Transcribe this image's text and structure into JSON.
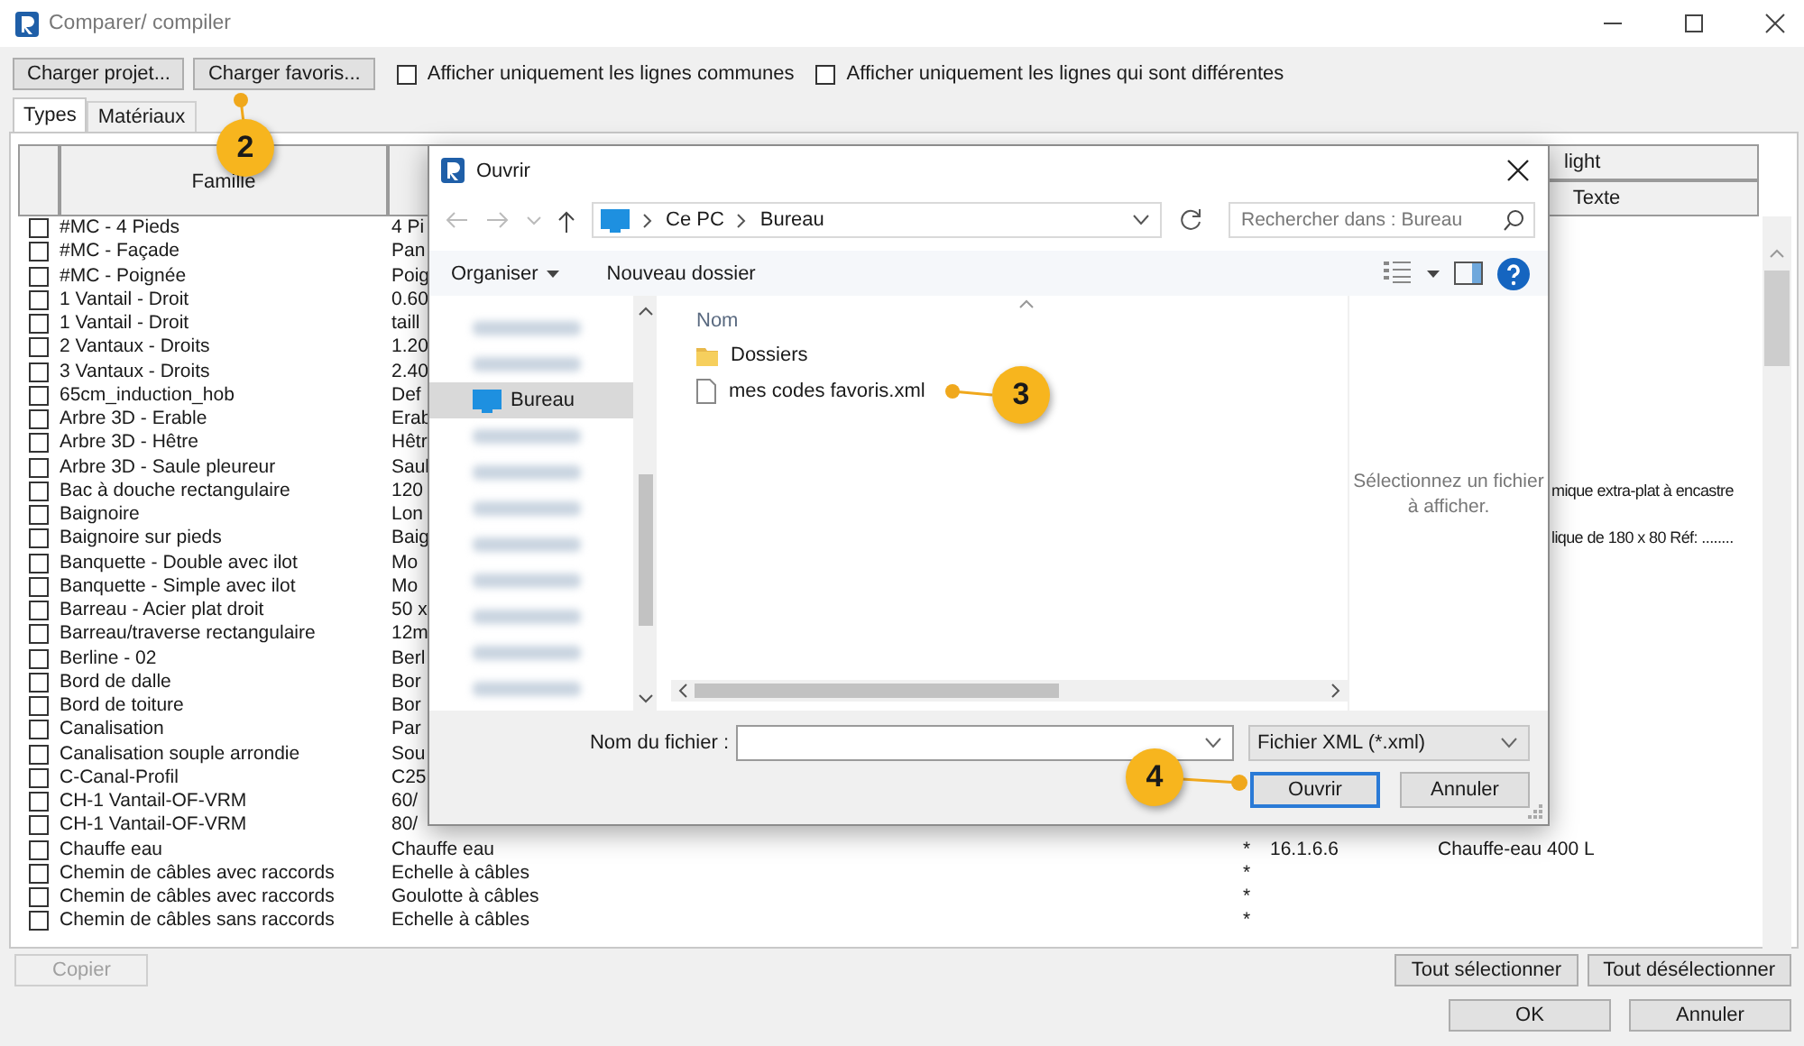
{
  "window": {
    "title": "Comparer/ compiler"
  },
  "toolbar": {
    "buttons": [
      {
        "label": "Charger projet..."
      },
      {
        "label": "Charger favoris..."
      }
    ],
    "filters": [
      {
        "label": "Afficher uniquement les lignes communes",
        "checked": false
      },
      {
        "label": "Afficher uniquement les lignes qui sont différentes",
        "checked": false
      }
    ]
  },
  "tabs": [
    {
      "label": "Types",
      "selected": true
    },
    {
      "label": "Matériaux",
      "selected": false
    }
  ],
  "table": {
    "columns": [
      {
        "label": "Famille"
      },
      {
        "label": "Texte"
      }
    ],
    "column_group": "light",
    "rows": [
      {
        "checked": false,
        "family": "#MC - 4 Pieds",
        "type": "4 Pi"
      },
      {
        "checked": false,
        "family": "#MC - Façade",
        "type": "Pan"
      },
      {
        "checked": false,
        "family": "#MC - Poignée",
        "type": "Poig"
      },
      {
        "checked": false,
        "family": "1 Vantail - Droit",
        "type": "0.60"
      },
      {
        "checked": false,
        "family": "1 Vantail - Droit",
        "type": "taill"
      },
      {
        "checked": false,
        "family": "2 Vantaux - Droits",
        "type": "1.20"
      },
      {
        "checked": false,
        "family": "3 Vantaux - Droits",
        "type": "2.40"
      },
      {
        "checked": false,
        "family": "65cm_induction_hob",
        "type": "Def"
      },
      {
        "checked": false,
        "family": "Arbre 3D - Erable",
        "type": "Erab"
      },
      {
        "checked": false,
        "family": "Arbre 3D - Hêtre",
        "type": "Hêtr"
      },
      {
        "checked": false,
        "family": "Arbre 3D - Saule pleureur",
        "type": "Saul"
      },
      {
        "checked": false,
        "family": "Bac à douche rectangulaire",
        "type": "120",
        "text": "mique extra-plat à encastre"
      },
      {
        "checked": false,
        "family": "Baignoire",
        "type": "Lon"
      },
      {
        "checked": false,
        "family": "Baignoire sur pieds",
        "type": "Baig",
        "text": "lique de 180 x 80 Réf: ........"
      },
      {
        "checked": false,
        "family": "Banquette - Double avec ilot",
        "type": "Mo"
      },
      {
        "checked": false,
        "family": "Banquette - Simple avec ilot",
        "type": "Mo"
      },
      {
        "checked": false,
        "family": "Barreau - Acier plat droit",
        "type": "50 x"
      },
      {
        "checked": false,
        "family": "Barreau/traverse rectangulaire",
        "type": "12m"
      },
      {
        "checked": false,
        "family": "Berline - 02",
        "type": "Berl"
      },
      {
        "checked": false,
        "family": "Bord de dalle",
        "type": "Bor"
      },
      {
        "checked": false,
        "family": "Bord de toiture",
        "type": "Bor"
      },
      {
        "checked": false,
        "family": "Canalisation",
        "type": "Par"
      },
      {
        "checked": false,
        "family": "Canalisation souple arrondie",
        "type": "Sou"
      },
      {
        "checked": false,
        "family": "C-Canal-Profil",
        "type": "C25"
      },
      {
        "checked": false,
        "family": "CH-1 Vantail-OF-VRM",
        "type": "60/"
      },
      {
        "checked": false,
        "family": "CH-1 Vantail-OF-VRM",
        "type": "80/"
      },
      {
        "checked": false,
        "family": "Chauffe eau",
        "type": "Chauffe eau",
        "marker": "*",
        "code": "16.1.6.6",
        "text": "Chauffe-eau 400 L"
      },
      {
        "checked": false,
        "family": "Chemin de câbles avec raccords",
        "type": "Echelle à câbles",
        "marker": "*"
      },
      {
        "checked": false,
        "family": "Chemin de câbles avec raccords",
        "type": "Goulotte à câbles",
        "marker": "*"
      },
      {
        "checked": false,
        "family": "Chemin de câbles sans raccords",
        "type": "Echelle à câbles",
        "marker": "*"
      }
    ]
  },
  "footer": {
    "copy": {
      "label": "Copier",
      "disabled": true
    },
    "selection": [
      "Tout sélectionner",
      "Tout désélectionner"
    ],
    "confirm": [
      "OK",
      "Annuler"
    ]
  },
  "open_dialog": {
    "title": "Ouvrir",
    "path": [
      "Ce PC",
      "Bureau"
    ],
    "search": {
      "placeholder": "Rechercher dans : Bureau"
    },
    "commands": [
      {
        "label": "Organiser",
        "menu": true
      },
      {
        "label": "Nouveau dossier",
        "menu": false
      }
    ],
    "nav": [
      {
        "kind": "blurred",
        "selected": false
      },
      {
        "kind": "blurred",
        "selected": false
      },
      {
        "kind": "place",
        "label": "Bureau",
        "selected": true
      },
      {
        "kind": "blurred",
        "selected": false
      },
      {
        "kind": "blurred",
        "selected": false
      },
      {
        "kind": "blurred",
        "selected": false
      },
      {
        "kind": "blurred",
        "selected": false
      },
      {
        "kind": "blurred",
        "selected": false
      },
      {
        "kind": "blurred",
        "selected": false
      },
      {
        "kind": "blurred",
        "selected": false
      },
      {
        "kind": "blurred",
        "selected": false
      }
    ],
    "list_header": "Nom",
    "files": [
      {
        "name": "Dossiers",
        "kind": "folder"
      },
      {
        "name": "mes codes favoris.xml",
        "kind": "file"
      }
    ],
    "preview": "Sélectionnez un fichier à afficher.",
    "filename": {
      "label": "Nom du fichier :"
    },
    "filetype": "Fichier XML (*.xml)",
    "buttons": [
      {
        "label": "Ouvrir",
        "default": true
      },
      {
        "label": "Annuler",
        "default": false
      }
    ]
  },
  "callouts": [
    {
      "number": "2"
    },
    {
      "number": "3"
    },
    {
      "number": "4"
    }
  ]
}
